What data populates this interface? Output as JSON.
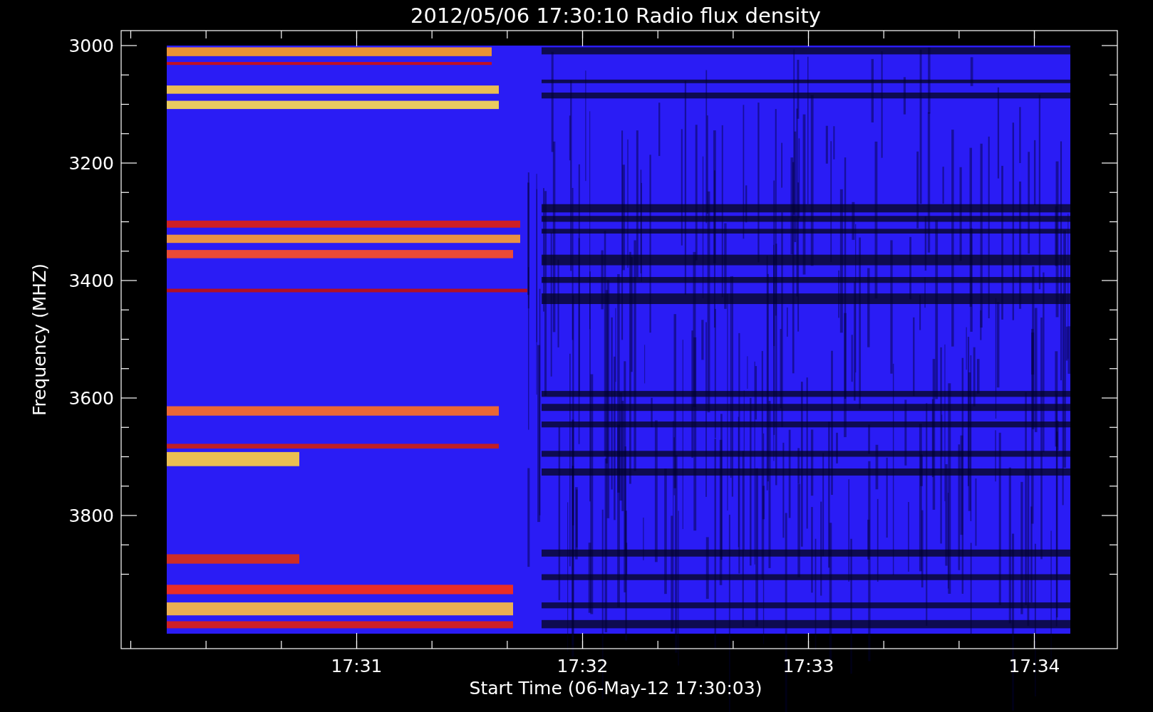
{
  "title": "2012/05/06 17:30:10 Radio flux density",
  "y_axis": {
    "label": "Frequency (MHZ)",
    "ticks": [
      "3000",
      "3200",
      "3400",
      "3600",
      "3800"
    ]
  },
  "x_axis": {
    "label": "Start Time (06-May-12 17:30:03)",
    "ticks": [
      "17:31",
      "17:32",
      "17:33",
      "17:34"
    ]
  }
}
